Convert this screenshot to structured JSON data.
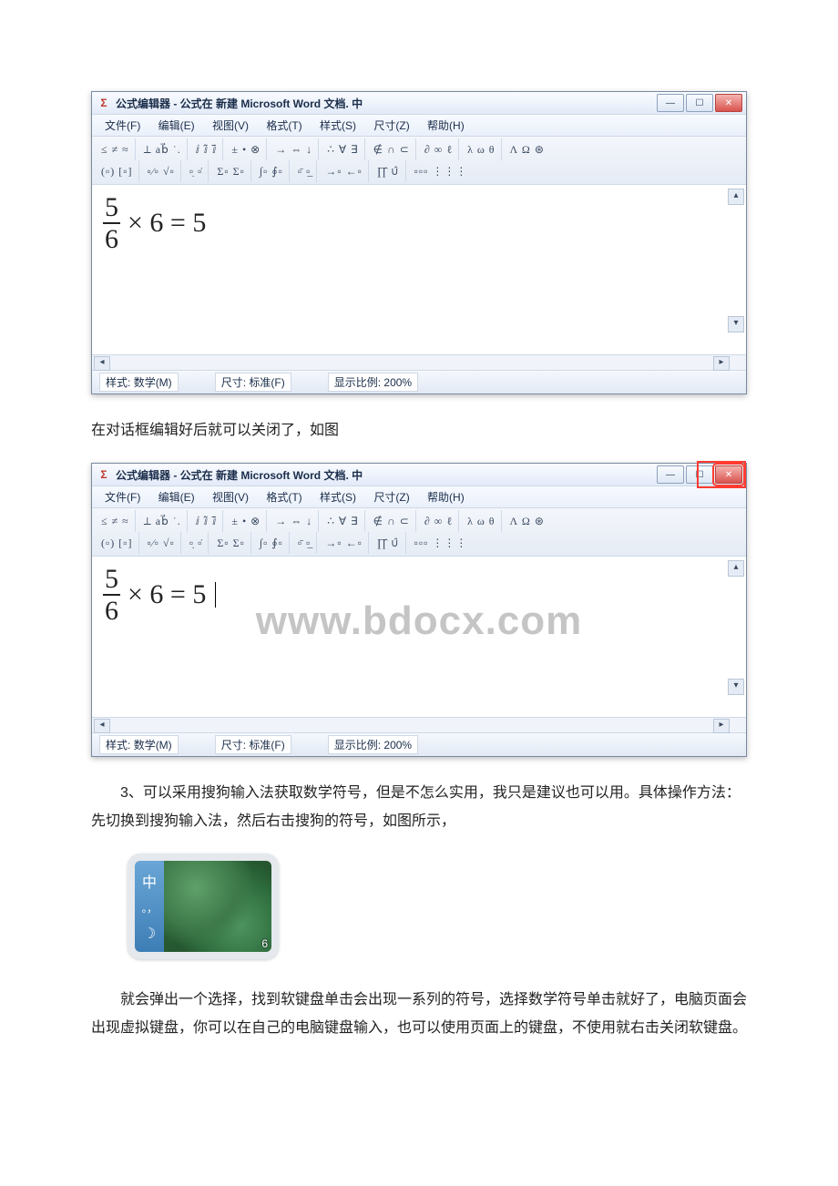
{
  "appWindow": {
    "title": "公式编辑器 - 公式在 新建 Microsoft Word 文档. 中",
    "menu": {
      "file": "文件(F)",
      "edit": "编辑(E)",
      "view": "视图(V)",
      "format": "格式(T)",
      "style": "样式(S)",
      "size": "尺寸(Z)",
      "help": "帮助(H)"
    },
    "toolbar": {
      "row1": {
        "relational": "≤ ≠ ≈",
        "spacing": "⟂ ab⃗ ˙.",
        "embellish": "ⅈ ⅈ̂ ⅈ̄",
        "operators": "± • ⊗",
        "arrows": "→ ⇔ ↓",
        "logical": "∴ ∀ ∃",
        "settheory": "∉ ∩ ⊂",
        "misc": "∂ ∞ ℓ",
        "greeklow": "λ ω θ",
        "greekup": "Λ Ω ⊛"
      },
      "row2": {
        "fences": "(▫) [▫]",
        "fracs": "▫⁄▫ √▫",
        "subsup": "▫̣ ▫̇",
        "sums": "Σ▫ Σ▫",
        "integrals": "∫▫ ∮▫",
        "bars": "▫̄ ▫̲",
        "labeledarr": "→▫ ←▫",
        "prodset": "∏̂ ∪̂",
        "matrices": "▫▫▫ ⋮⋮⋮"
      }
    },
    "equation": {
      "num": "5",
      "den": "6",
      "rest": "× 6 = 5"
    },
    "status": {
      "styleLabel": "样式:",
      "styleValue": "数学(M)",
      "sizeLabel": "尺寸:",
      "sizeValue": "标准(F)",
      "zoomLabel": "显示比例:",
      "zoomValue": "200%"
    },
    "winControls": {
      "min": "—",
      "max": "☐",
      "close": "✕"
    },
    "scroll": {
      "up": "▴",
      "down": "▾",
      "left": "◂",
      "right": "▸"
    }
  },
  "watermark": "www.bdocx.com",
  "paragraphs": {
    "p1": "在对话框编辑好后就可以关闭了，如图",
    "p2": "3、可以采用搜狗输入法获取数学符号，但是不怎么实用，我只是建议也可以用。具体操作方法：先切换到搜狗输入法，然后右击搜狗的符号，如图所示，",
    "p3": "就会弹出一个选择，找到软键盘单击会出现一系列的符号，选择数学符号单击就好了，电脑页面会出现虚拟键盘，你可以在自己的电脑键盘输入，也可以使用页面上的键盘，不使用就右击关闭软键盘。"
  },
  "ime": {
    "char": "中",
    "punct": "。，",
    "moon": "☽",
    "skin_num": "6"
  }
}
